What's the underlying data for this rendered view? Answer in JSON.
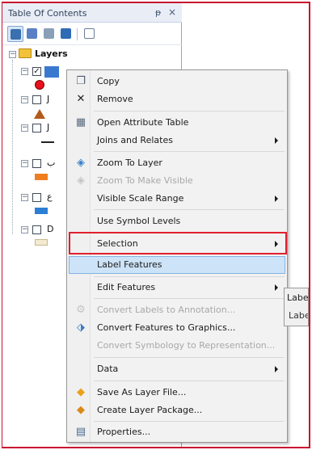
{
  "toc": {
    "title": "Table Of Contents",
    "pin_glyph": "p̷",
    "close_glyph": "×",
    "toolbar": [
      {
        "icon": "list-by-drawing-order-icon",
        "color": "#3a6fb0"
      },
      {
        "icon": "list-by-source-icon",
        "color": "#5b7fc4"
      },
      {
        "icon": "list-by-visibility-icon",
        "color": "#8aa0b8"
      },
      {
        "icon": "list-by-selection-icon",
        "color": "#2e6bb5"
      },
      {
        "icon": "options-icon",
        "color": "#6a7f98"
      }
    ],
    "layers_label": "Layers",
    "expander_symbol": "−",
    "check_symbol": "✓",
    "fragments": [
      "J",
      "J",
      "ب",
      "ع",
      "D"
    ]
  },
  "menu": {
    "items": [
      {
        "label": "Copy",
        "icon": "copy-icon",
        "disabled": false,
        "submenu": false
      },
      {
        "label": "Remove",
        "icon": "remove-icon",
        "disabled": false,
        "submenu": false
      },
      {
        "label": "Open Attribute Table",
        "icon": "attribute-table-icon",
        "disabled": false,
        "submenu": false
      },
      {
        "label": "Joins and Relates",
        "icon": "",
        "disabled": false,
        "submenu": true
      },
      {
        "label": "Zoom To Layer",
        "icon": "zoom-to-layer-icon",
        "disabled": false,
        "submenu": false
      },
      {
        "label": "Zoom To Make Visible",
        "icon": "zoom-to-make-visible-icon",
        "disabled": true,
        "submenu": false
      },
      {
        "label": "Visible Scale Range",
        "icon": "",
        "disabled": false,
        "submenu": true
      },
      {
        "label": "Use Symbol Levels",
        "icon": "",
        "disabled": false,
        "submenu": false
      },
      {
        "label": "Selection",
        "icon": "",
        "disabled": false,
        "submenu": true
      },
      {
        "label": "Label Features",
        "icon": "",
        "disabled": false,
        "submenu": false
      },
      {
        "label": "Edit Features",
        "icon": "",
        "disabled": false,
        "submenu": true
      },
      {
        "label": "Convert Labels to Annotation...",
        "icon": "convert-labels-icon",
        "disabled": true,
        "submenu": false
      },
      {
        "label": "Convert Features to Graphics...",
        "icon": "convert-features-icon",
        "disabled": false,
        "submenu": false
      },
      {
        "label": "Convert Symbology to Representation...",
        "icon": "",
        "disabled": true,
        "submenu": false
      },
      {
        "label": "Data",
        "icon": "",
        "disabled": false,
        "submenu": true
      },
      {
        "label": "Save As Layer File...",
        "icon": "save-layer-file-icon",
        "disabled": false,
        "submenu": false
      },
      {
        "label": "Create Layer Package...",
        "icon": "create-layer-package-icon",
        "disabled": false,
        "submenu": false
      },
      {
        "label": "Properties...",
        "icon": "properties-icon",
        "disabled": false,
        "submenu": false
      }
    ]
  },
  "tooltip": {
    "title": "Label Fe",
    "text": "Label th"
  },
  "colors": {
    "highlight_border": "#e0202e",
    "frame_border": "#c8102e",
    "layer_circle": "#e8101c",
    "layer_triangle": "#b35a1b",
    "layer_orange": "#f07e1f",
    "layer_blue": "#2b7fd4",
    "layer_beige": "#f3ead0"
  }
}
